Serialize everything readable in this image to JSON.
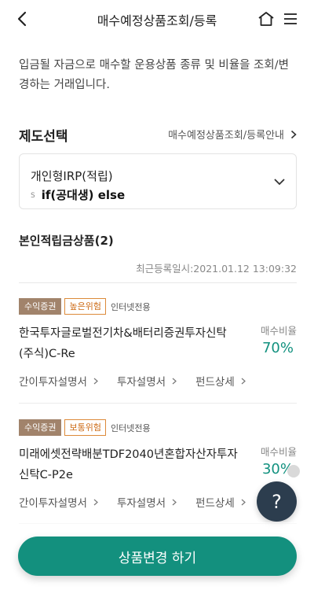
{
  "header": {
    "title": "매수예정상품조회/등록",
    "icons": [
      "back-arrow-icon",
      "home-icon",
      "hamburger-menu-icon"
    ]
  },
  "intro": "입금될 자금으로 매수할 운용상품 종류 및 비율을 조회/변경하는 거래입니다.",
  "plan_section": {
    "title": "제도선택",
    "guide_link": "매수예정상품조회/등록안내",
    "select_value": "개인형IRP(적립)",
    "overlay_mark": "S",
    "overlay_text": "if(공대생) else"
  },
  "products_section": {
    "title": "본인적립금상품(2)",
    "last_registered": "최근등록일시:2021.01.12 13:09:32"
  },
  "products": [
    {
      "badge_type": "수익증권",
      "badge_risk": "높은위험",
      "badge_channel": "인터넷전용",
      "name": "한국투자글로벌전기차&배터리증권투자신탁(주식)C-Re",
      "ratio_label": "매수비율",
      "ratio": "70%",
      "ratio_value": 70,
      "links": [
        "간이투자설명서",
        "투자설명서",
        "펀드상세"
      ]
    },
    {
      "badge_type": "수익증권",
      "badge_risk": "보통위험",
      "badge_channel": "인터넷전용",
      "name": "미래에셋전략배분TDF2040년혼합자산자투자신탁C-P2e",
      "ratio_label": "매수비율",
      "ratio": "30%",
      "ratio_value": 30,
      "links": [
        "간이투자설명서",
        "투자설명서",
        "펀드상세"
      ]
    }
  ],
  "help_button": "?",
  "cta_button": "상품변경 하기",
  "colors": {
    "accent": "#13907e",
    "ratio_text": "#12917f",
    "badge_fill": "#a1836b",
    "risk_border": "#dc8a3a",
    "help_bg": "#2c3d4e"
  }
}
